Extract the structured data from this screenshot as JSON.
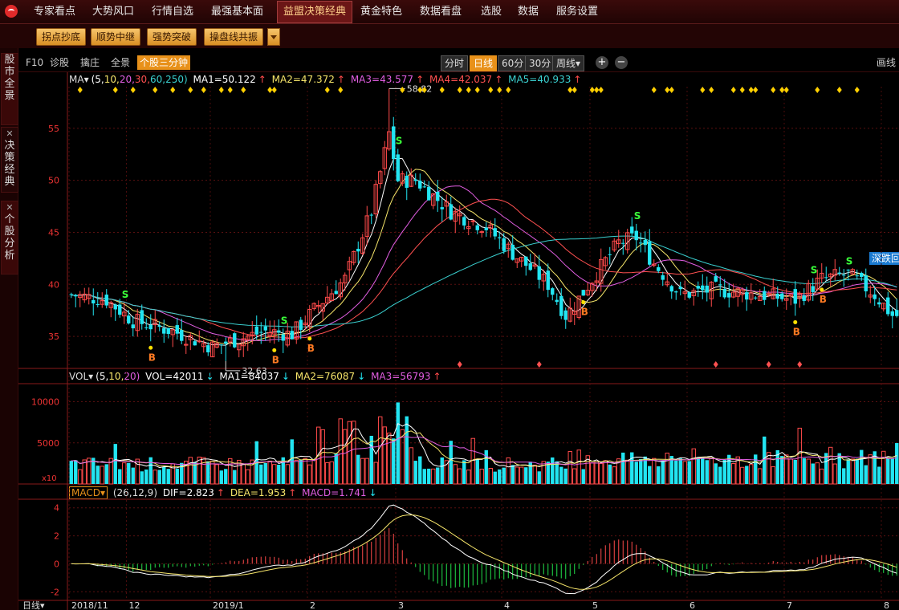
{
  "nav": {
    "items": [
      {
        "label": "专家看点",
        "active": false
      },
      {
        "label": "大势风口",
        "active": false
      },
      {
        "label": "行情自选",
        "active": false
      },
      {
        "label": "最强基本面",
        "active": false
      },
      {
        "label": "益盟决策经典",
        "active": true
      },
      {
        "label": "黄金特色",
        "active": false
      },
      {
        "label": "数据看盘",
        "active": false
      },
      {
        "label": "选股",
        "active": false
      },
      {
        "label": "数据",
        "active": false
      },
      {
        "label": "服务设置",
        "active": false
      }
    ]
  },
  "subbar": {
    "buttons": [
      "拐点抄底",
      "顺势中继",
      "强势突破",
      "操盘线共振"
    ],
    "dropdown_icon": "triangle-down-icon"
  },
  "sidebar": {
    "tabs": [
      "股市全景",
      "决策经典",
      "个股分析"
    ]
  },
  "toolbar": {
    "left": [
      "F10",
      "诊股",
      "擒庄",
      "全景",
      "个股三分钟"
    ],
    "periods": [
      "分时",
      "日线",
      "60分",
      "30分",
      "周线▾"
    ],
    "active_period": "日线",
    "zoom_in": "+",
    "zoom_out": "−",
    "right": "画线"
  },
  "ma_legend": {
    "name": "MA▾",
    "params": [
      "(5,",
      "10,",
      "20,",
      "30,",
      "60,",
      "250)"
    ],
    "values": [
      "MA1=50.122",
      "MA2=47.372",
      "MA3=43.577",
      "MA4=42.037",
      "MA5=40.933"
    ],
    "arrow": "↑"
  },
  "vol_legend": {
    "name": "VOL▾",
    "params": [
      "(5,",
      "10,",
      "20)"
    ],
    "values": [
      "VOL=42011",
      "MA1=84037",
      "MA2=76087",
      "MA3=56793"
    ],
    "arrows": [
      "↓",
      "↓",
      "↓",
      "↑"
    ]
  },
  "macd_legend": {
    "name": "MACD▾",
    "params": "(26,12,9)",
    "values": [
      "DIF=2.823",
      "DEA=1.953",
      "MACD=1.741"
    ],
    "arrows": [
      "↑",
      "↑",
      "↓"
    ]
  },
  "annotations": {
    "high": "58.82",
    "low": "32.63",
    "tag": "深跌回",
    "x10": "x10"
  },
  "colors": {
    "up": "#ff4a4a",
    "down": "#22e5f2",
    "ma1": "#ffffff",
    "ma2": "#f6e56a",
    "ma3": "#e25ee2",
    "ma4": "#ff5050",
    "ma5": "#3ad0d0",
    "dif": "#ffffff",
    "dea": "#f6e56a",
    "macd_pos": "#ff4a4a",
    "macd_neg": "#22e04a",
    "accent": "#e8911a"
  },
  "chart_data": [
    {
      "type": "candlestick",
      "title": "",
      "y_ticks": [
        35,
        40,
        45,
        50,
        55
      ],
      "ylim": [
        32,
        59
      ],
      "x_labels": [
        "2018/11",
        "12",
        "2019/1",
        "2",
        "3",
        "4",
        "5",
        "6",
        "7",
        "8"
      ],
      "close_anchors": [
        [
          0,
          39
        ],
        [
          8,
          38.5
        ],
        [
          14,
          36.5
        ],
        [
          23,
          35.5
        ],
        [
          32,
          34
        ],
        [
          44,
          35.5
        ],
        [
          50,
          35.2
        ],
        [
          56,
          38
        ],
        [
          62,
          40.5
        ],
        [
          68,
          47
        ],
        [
          72,
          54.5
        ],
        [
          74,
          50
        ],
        [
          78,
          50
        ],
        [
          86,
          47
        ],
        [
          94,
          45.5
        ],
        [
          100,
          43
        ],
        [
          108,
          40
        ],
        [
          112,
          37
        ],
        [
          114,
          38
        ],
        [
          118,
          40.5
        ],
        [
          124,
          44
        ],
        [
          128,
          44.5
        ],
        [
          132,
          42
        ],
        [
          138,
          39
        ],
        [
          146,
          39.5
        ],
        [
          156,
          39
        ],
        [
          164,
          38.5
        ],
        [
          170,
          40.5
        ],
        [
          176,
          41
        ],
        [
          182,
          39
        ],
        [
          186,
          37
        ]
      ],
      "signals_B": [
        18,
        46,
        54,
        116,
        164,
        170
      ],
      "signals_S": [
        12,
        48,
        74,
        128,
        168,
        176
      ],
      "high": 58.82,
      "low": 32.63
    },
    {
      "type": "bar",
      "title": "VOL",
      "y_ticks": [
        5000,
        10000
      ],
      "ylim": [
        0,
        12000
      ]
    },
    {
      "type": "bar",
      "title": "MACD",
      "y_ticks": [
        -2,
        0,
        2,
        4
      ],
      "ylim": [
        -2.5,
        4.5
      ]
    }
  ]
}
